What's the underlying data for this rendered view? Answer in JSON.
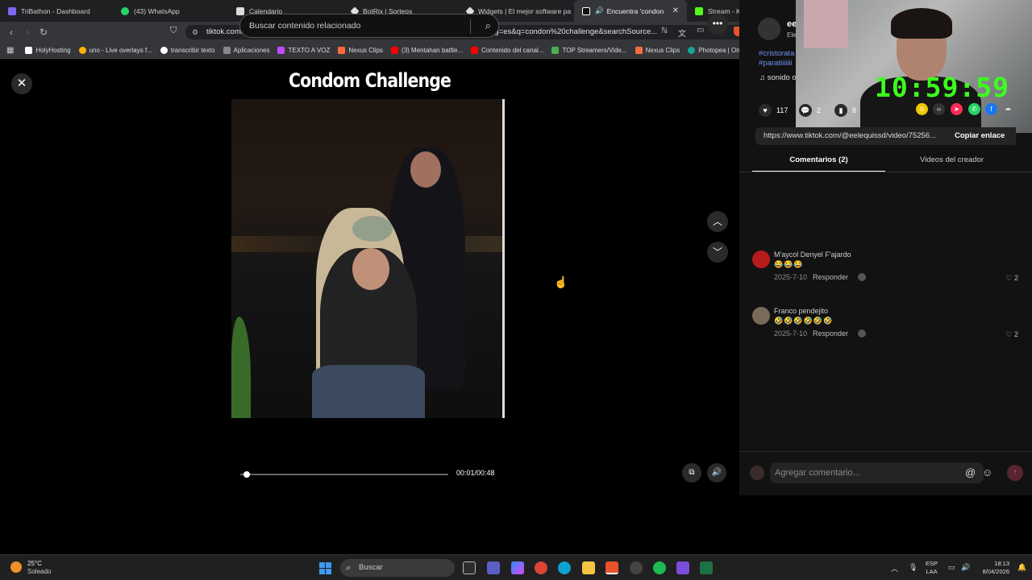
{
  "browser": {
    "tabs": [
      {
        "label": "TriBathon - Dashboard",
        "color": "#7b68ee"
      },
      {
        "label": "(43) WhatsApp",
        "color": "#25d366"
      },
      {
        "label": "Calendario",
        "color": "#ffffff"
      },
      {
        "label": "BotRix | Sorteos",
        "color": "#ffffff"
      },
      {
        "label": "Widgets | El mejor software pa",
        "color": "#ffffff"
      },
      {
        "label": "Encuentra 'condon cha",
        "color": "#ffffff",
        "active": true
      },
      {
        "label": "Stream - Kick Dashboard",
        "color": "#53fc18"
      }
    ],
    "url": "tiktok.com/@eelequissd/video/7525670357844397317?enterMethod=click_enter&lang=es&q=condon%20challenge&searchSource...",
    "bookmarks": [
      {
        "label": "HolyHosting",
        "color": "#ffffff"
      },
      {
        "label": "uno - Live overlays f...",
        "color": "#ffb300"
      },
      {
        "label": "transcribir texto",
        "color": "#ffffff"
      },
      {
        "label": "Aplicaciones",
        "color": "#888888"
      },
      {
        "label": "TEXTO A VOZ",
        "color": "#c04cff"
      },
      {
        "label": "Nexus Clips",
        "color": "#ff6a3d"
      },
      {
        "label": "(3) Mentahan battle...",
        "color": "#ff0000"
      },
      {
        "label": "Contenido del canal...",
        "color": "#ff0000"
      },
      {
        "label": "TOP Streamers/Vide...",
        "color": "#4caf50"
      },
      {
        "label": "Nexus Clips",
        "color": "#ff6a3d"
      },
      {
        "label": "Photopea | Online P...",
        "color": "#18a497"
      }
    ]
  },
  "video": {
    "search_placeholder": "Buscar contenido relacionado",
    "title": "Condom Challenge",
    "time": "00:01/00:48",
    "progress": 0.02
  },
  "creator": {
    "name": "ee",
    "subtitle": "Ele",
    "hashtag1": "#cristorata",
    "hashtag2": "#paratiiiiiii",
    "sound": "♫  sonido original - Elequizzz"
  },
  "overlay": {
    "clock": "10:59:59"
  },
  "stats": {
    "likes": "117",
    "comments": "2",
    "saves": "8"
  },
  "share": {
    "link": "https://www.tiktok.com/@eelequissd/video/75256...",
    "copy_label": "Copiar enlace"
  },
  "tabs": {
    "comments": "Comentarios (2)",
    "videos": "Videos del creador"
  },
  "comments": [
    {
      "name": "M'aycol Denyel F'ajardo",
      "emojis": "😂😂😂",
      "date": "2025-7-10",
      "reply": "Responder",
      "likes": "♡ 2",
      "avatar_color": "#b71c1c"
    },
    {
      "name": "Franco pendejito",
      "emojis": "🤣🤣🤣🤣🤣🤣",
      "date": "2025-7-10",
      "reply": "Responder",
      "likes": "♡ 2",
      "avatar_color": "#7a6a5a"
    }
  ],
  "comment_input": {
    "placeholder": "Agregar comentario..."
  },
  "taskbar": {
    "temp": "25°C",
    "weather": "Soleado",
    "search": "Buscar",
    "lang1": "ESP",
    "lang2": "LAA",
    "time": "18:13",
    "date": "8/04/2026"
  }
}
